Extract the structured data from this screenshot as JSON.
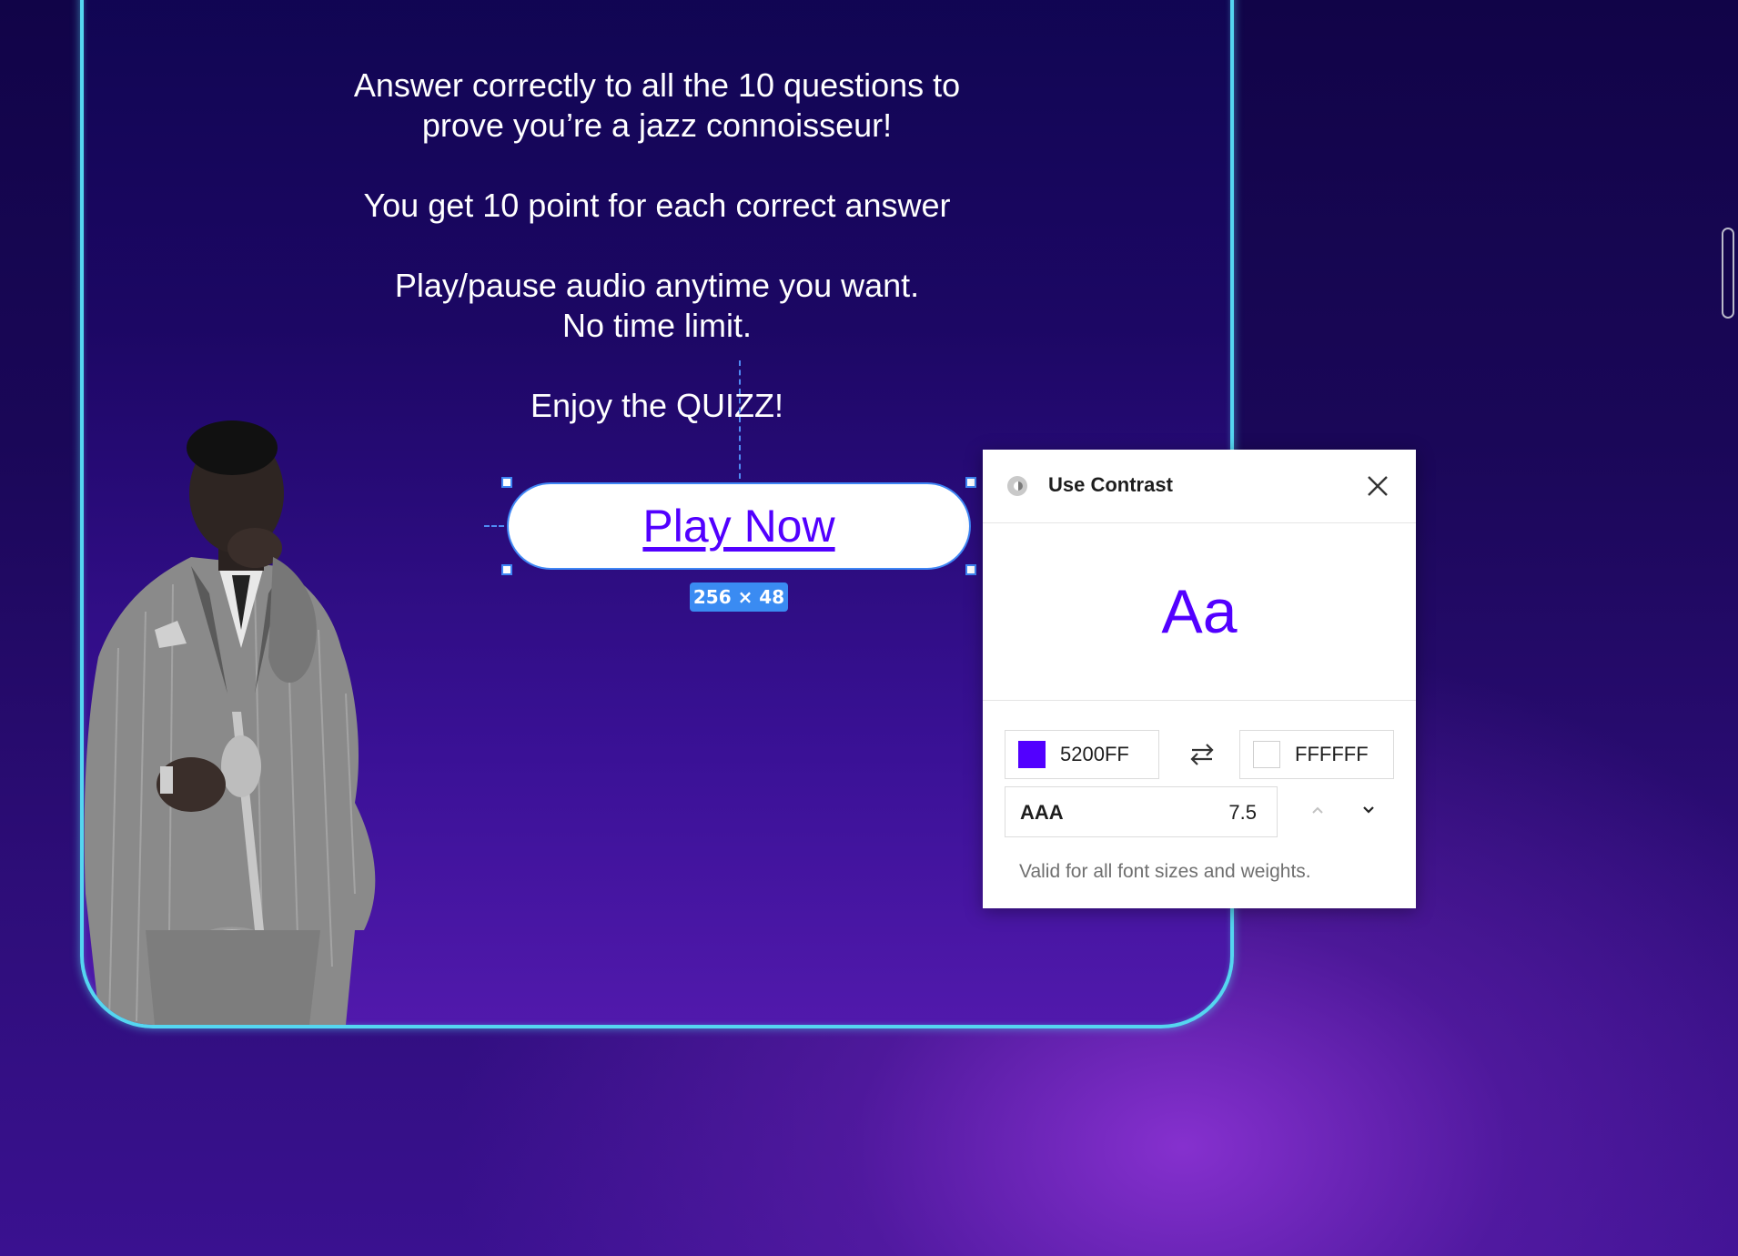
{
  "quiz": {
    "intro_line1": "Answer correctly to all the 10 questions to",
    "intro_line2": "prove you’re a jazz connoisseur!",
    "points_rule": "You get 10 point for each correct answer",
    "audio_line1": "Play/pause audio anytime you want.",
    "audio_line2": "No time limit.",
    "enjoy": "Enjoy the QUIZZ!",
    "play_button_label": "Play Now"
  },
  "selection": {
    "size_label": "256 × 48"
  },
  "contrast_panel": {
    "title": "Use Contrast",
    "preview_text": "Aa",
    "foreground_hex": "5200FF",
    "background_hex": "FFFFFF",
    "level": "AAA",
    "ratio": "7.5",
    "validity_text": "Valid for all font sizes and weights."
  },
  "colors": {
    "accent": "#5200FF",
    "frame_border": "#55D6F0",
    "selection": "#3F86F5"
  },
  "icons": [
    "contrast-logo-icon",
    "close-icon",
    "swap-icon",
    "chevron-up-icon",
    "chevron-down-icon",
    "jazz-musician-photo"
  ]
}
